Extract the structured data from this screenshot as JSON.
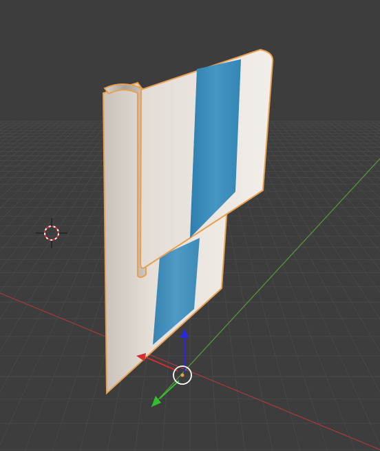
{
  "app": {
    "name": "3D Viewport"
  },
  "viewport": {
    "background_color": "#3d3d3d",
    "grid_color": "#4a4a4a",
    "grid_visible": true
  },
  "axes": {
    "x_axis_color": "#a83a3a",
    "y_axis_color": "#5a9a3a"
  },
  "object": {
    "type": "folded-towel-mesh",
    "selected": true,
    "outline_color": "#e8a050",
    "base_color": "#e9e3dc",
    "stripe_color": "#3d8fbc"
  },
  "gizmo": {
    "x_handle_color": "#d03030",
    "y_handle_color": "#30c030",
    "z_handle_color": "#2828e0",
    "pivot_color": "#ffffff"
  },
  "cursor": {
    "outer_color": "#ffffff",
    "inner_color": "#d83030"
  },
  "icons": {
    "cursor": "3d-cursor-icon",
    "pivot": "pivot-ring-icon"
  }
}
